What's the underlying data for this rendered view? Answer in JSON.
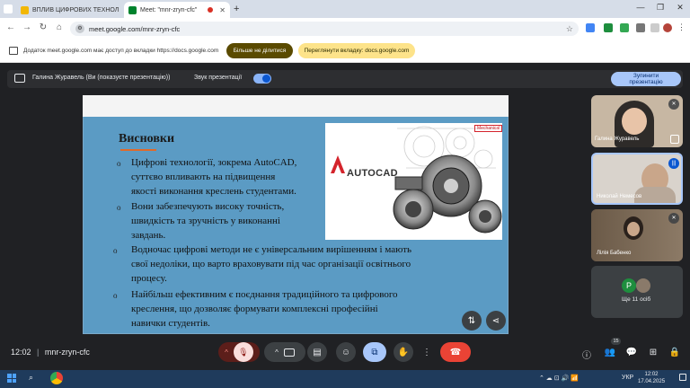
{
  "browser": {
    "tabs": [
      {
        "title": "ВПЛИВ ЦИФРОВИХ ТЕХНОЛ",
        "active": false,
        "favicon_color": "#f2b705"
      },
      {
        "title": "Meet: \"mnr-zryn-cfc\"",
        "active": true,
        "favicon_color": "#00832d"
      }
    ],
    "new_tab_glyph": "+",
    "url": "meet.google.com/mnr-zryn-cfc"
  },
  "infobar": {
    "text": "Додаток meet.google.com має доступ до вкладки https://docs.google.com",
    "stop_sharing": "Більше не ділитися",
    "view_tab": "Переглянути вкладку: docs.google.com"
  },
  "presentation": {
    "presenter": "Галина Журавель (Ви (показуєте презентацію))",
    "sound_label": "Звук презентації",
    "stop_line1": "Зупинити",
    "stop_line2": "презентацію"
  },
  "slide": {
    "title": "Висновки",
    "bullets": [
      [
        "Цифрові технології, зокрема AutoCAD,",
        "суттєво впливають на підвищення",
        "якості виконання креслень студентами."
      ],
      [
        "Вони забезпечують високу точність,",
        "швидкість та зручність у виконанні",
        "завдань."
      ],
      [
        "Водночас цифрові методи не є універсальним вирішенням і мають",
        "свої недоліки, що варто враховувати під час організації освітнього",
        "процесу."
      ],
      [
        "Найбільш ефективним є поєднання традиційного та цифрового",
        "креслення, що дозволяє формувати комплексні професійні",
        "навички студентів."
      ]
    ],
    "image": {
      "brand": "AUTOCAD",
      "tag": "Mechanical"
    }
  },
  "participants": [
    {
      "name": "Галина Журавель"
    },
    {
      "name": "Николай Немесов"
    },
    {
      "name": "Лілія Бабенко"
    }
  ],
  "more_tile": {
    "initial": "P",
    "label": "Ще 11 осіб"
  },
  "bottom": {
    "time": "12:02",
    "separator": "|",
    "meeting_code": "mnr-zryn-cfc",
    "people_count": "15"
  },
  "taskbar": {
    "lang": "УКР",
    "time": "12:02",
    "date": "17.04.2025"
  },
  "colors": {
    "accent": "#8ab4f8",
    "end_call": "#ea4335",
    "mic_off": "#5c1e1a",
    "present_active": "#a8c7fa"
  }
}
